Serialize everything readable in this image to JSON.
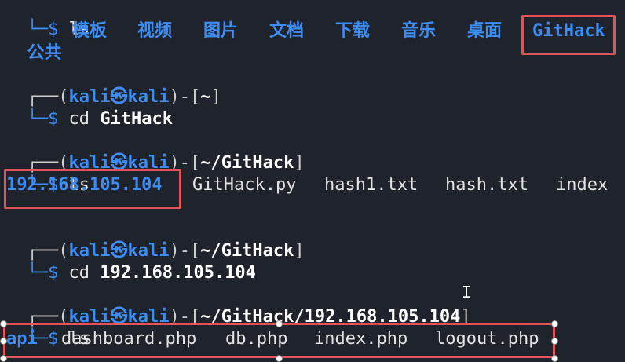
{
  "accent_blue": "#3d8df5",
  "highlight_red": "#e05555",
  "top": {
    "prompt": "└─$",
    "cmd": "ls",
    "folders": [
      "公共",
      "模板",
      "视频",
      "图片",
      "文档",
      "下载",
      "音乐",
      "桌面"
    ],
    "highlight": "GitHack"
  },
  "block1": {
    "prompt_open": "┌──(",
    "user": "kali㉿kali",
    "prompt_mid": ")-[",
    "path": "~",
    "prompt_close": "]",
    "dollar": "└─$",
    "cmd": "cd",
    "arg": "GitHack"
  },
  "block2": {
    "prompt_open": "┌──(",
    "user": "kali㉿kali",
    "prompt_mid": ")-[",
    "path": "~/GitHack",
    "prompt_close": "]",
    "dollar": "└─$",
    "cmd": "ls",
    "dir_out": "192.168.105.104",
    "files": [
      "GitHack.py",
      "hash1.txt",
      "hash.txt",
      "index"
    ]
  },
  "block3": {
    "prompt_open": "┌──(",
    "user": "kali㉿kali",
    "prompt_mid": ")-[",
    "path": "~/GitHack",
    "prompt_close": "]",
    "dollar": "└─$",
    "cmd": "cd",
    "arg": "192.168.105.104"
  },
  "block4": {
    "prompt_open": "┌──(",
    "user": "kali㉿kali",
    "prompt_mid": ")-[",
    "path": "~/GitHack/192.168.105.104",
    "prompt_close": "]",
    "dollar": "└─$",
    "cmd": "ls",
    "dir_out": "api",
    "files": [
      "dashboard.php",
      "db.php",
      "index.php",
      "logout.php"
    ]
  },
  "text_cursor": "I"
}
